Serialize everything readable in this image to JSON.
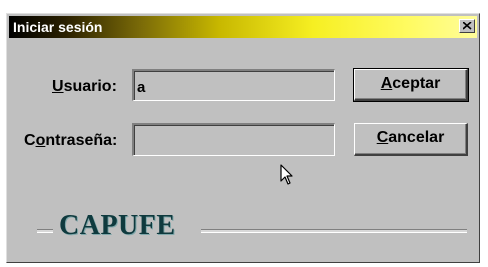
{
  "window": {
    "title": "Iniciar sesión",
    "close_icon": "close-icon"
  },
  "form": {
    "usuario_label_prefix": "",
    "usuario_label_accel": "U",
    "usuario_label_rest": "suario:",
    "usuario_value": "a",
    "contrasena_label_prefix": "C",
    "contrasena_label_accel": "o",
    "contrasena_label_rest": "ntraseña:",
    "contrasena_value": ""
  },
  "buttons": {
    "aceptar_accel": "A",
    "aceptar_rest": "ceptar",
    "cancelar_accel": "C",
    "cancelar_rest": "ancelar"
  },
  "branding": {
    "logo_text": "CAPUFE"
  }
}
